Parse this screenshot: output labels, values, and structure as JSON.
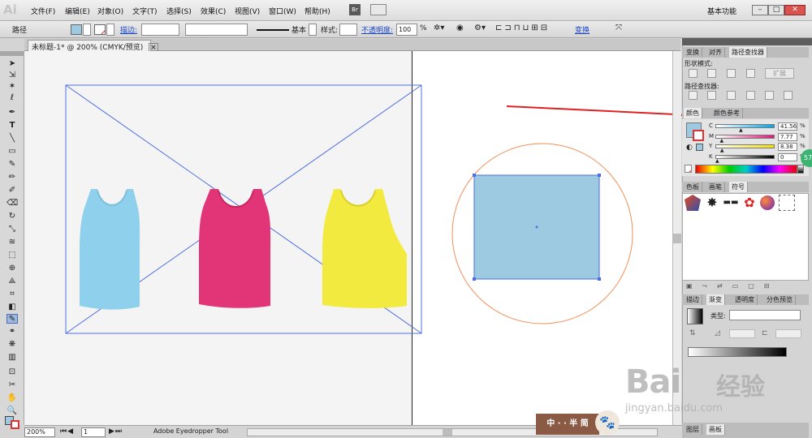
{
  "app": {
    "logo": "Ai",
    "workspace": "基本功能"
  },
  "menu": [
    "文件(F)",
    "编辑(E)",
    "对象(O)",
    "文字(T)",
    "选择(S)",
    "效果(C)",
    "视图(V)",
    "窗口(W)",
    "帮助(H)"
  ],
  "menu_extra": {
    "br": "Br"
  },
  "control_bar": {
    "object_type": "路径",
    "stroke_label": "描边:",
    "brush_style": "基本",
    "style_label": "样式:",
    "opacity_label": "不透明度:",
    "opacity_value": "100",
    "opacity_unit": "%",
    "transform_link": "变换"
  },
  "document": {
    "tab_title": "未标题-1* @ 200% (CMYK/预览)",
    "close": "×"
  },
  "statusbar": {
    "zoom": "200%",
    "page": "1",
    "tool_name": "Adobe Eyedropper Tool"
  },
  "panels": {
    "pathfinder_tabs": [
      "变换",
      "对齐",
      "路径查找器"
    ],
    "shape_modes_label": "形状模式:",
    "expand_button": "扩展",
    "pathfinders_label": "路径查找器:",
    "color_tabs": [
      "颜色",
      "颜色参考"
    ],
    "color": {
      "channels": [
        {
          "name": "C",
          "value": "41.56",
          "unit": "%",
          "fill": 0.4156
        },
        {
          "name": "M",
          "value": "7.77",
          "unit": "%",
          "fill": 0.0777
        },
        {
          "name": "Y",
          "value": "8.38",
          "unit": "%",
          "fill": 0.0838
        },
        {
          "name": "K",
          "value": "0",
          "unit": "%",
          "fill": 0
        }
      ],
      "fill_color": "#9ecae1"
    },
    "swatch_tabs": [
      "色板",
      "画笔",
      "符号"
    ],
    "gradient_tabs": [
      "描边",
      "渐变",
      "透明度",
      "分色预览"
    ],
    "gradient_type_label": "类型:",
    "layers_tabs": [
      "图层",
      "画板"
    ]
  },
  "canvas": {
    "tank_colors": [
      "#8fd0ec",
      "#e23577",
      "#f2ea3e"
    ],
    "rectangle_fill": "#9ecae1",
    "circle_stroke": "#f0905a",
    "placed_image_border": "#4f6fe0"
  },
  "overlays": {
    "badge": "中 · · 半 简",
    "baidu_logo": "Bai",
    "baidu_jingyan": "经验",
    "baidu_url": "jingyan.baidu.com",
    "green_badge": "57"
  }
}
